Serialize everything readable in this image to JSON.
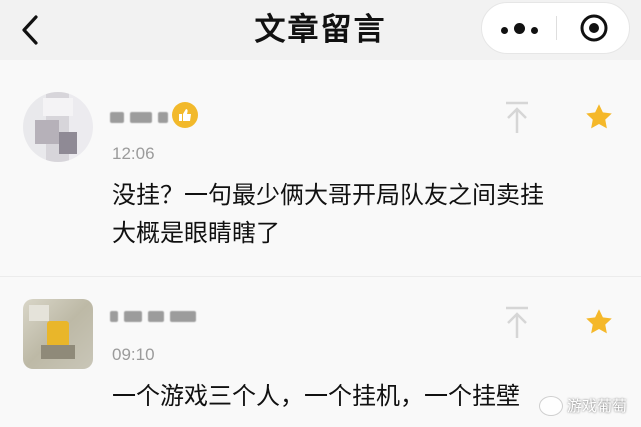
{
  "header": {
    "title": "文章留言",
    "back_icon": "chevron-left-icon",
    "more_icon": "more-dots-icon",
    "target_icon": "target-circle-icon"
  },
  "comments": [
    {
      "nickname": "",
      "time": "12:06",
      "text_line1": "没挂？一句最少俩大哥开局队友之间卖挂",
      "text_line2": "大概是眼睛瞎了",
      "badge_icon": "thumbs-up-badge-icon",
      "pin_icon": "pin-to-top-icon",
      "star_icon": "star-icon",
      "star_color": "#f5b82a"
    },
    {
      "nickname": "",
      "time": "09:10",
      "text_line1": "一个游戏三个人，一个挂机，一个挂壁",
      "pin_icon": "pin-to-top-icon",
      "star_icon": "star-icon",
      "star_color": "#f5b82a"
    }
  ],
  "watermark": {
    "text": "游戏葡萄"
  }
}
